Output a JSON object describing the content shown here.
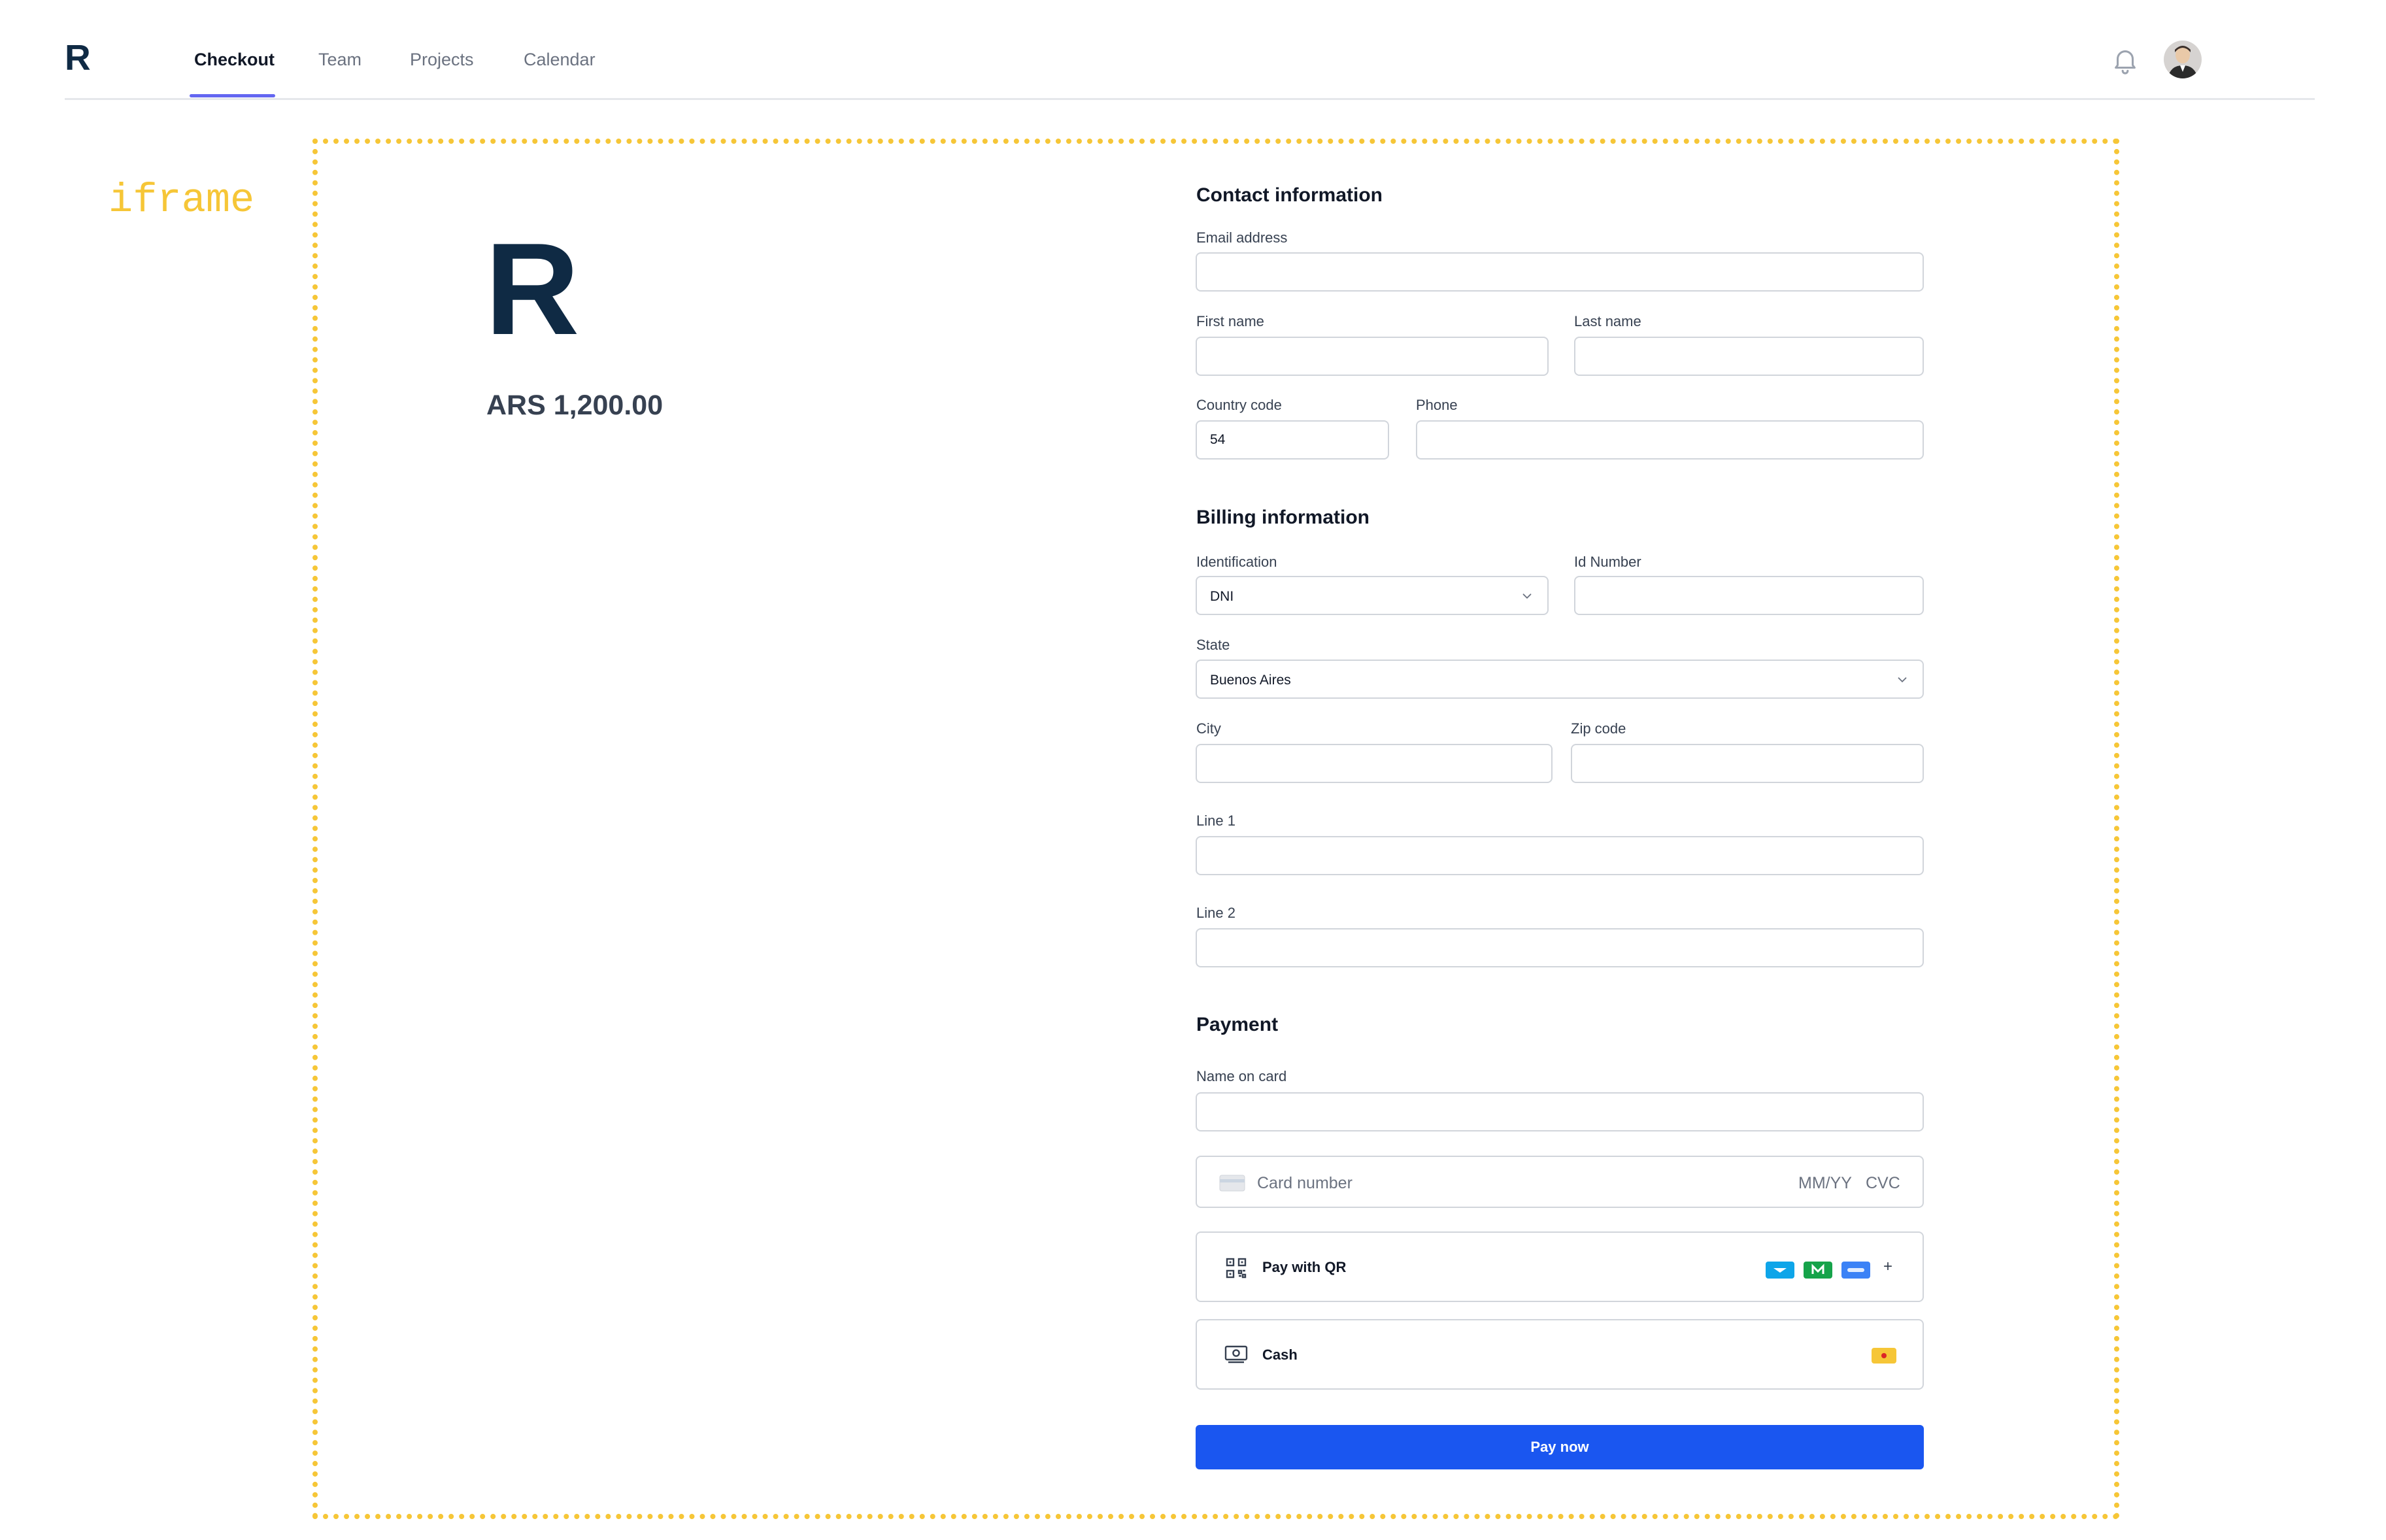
{
  "nav": {
    "brand": "R",
    "links": [
      "Checkout",
      "Team",
      "Projects",
      "Calendar"
    ]
  },
  "frame": {
    "tag": "iframe"
  },
  "summary": {
    "logo": "R",
    "amount": "ARS 1,200.00"
  },
  "contact": {
    "title": "Contact information",
    "email_label": "Email address",
    "first_name_label": "First name",
    "last_name_label": "Last name",
    "country_code_label": "Country code",
    "country_code_value": "54",
    "phone_label": "Phone"
  },
  "billing": {
    "title": "Billing information",
    "identification_label": "Identification",
    "identification_value": "DNI",
    "id_number_label": "Id Number",
    "state_label": "State",
    "state_value": "Buenos Aires",
    "city_label": "City",
    "zip_label": "Zip code",
    "line1_label": "Line 1",
    "line2_label": "Line 2"
  },
  "payment": {
    "title": "Payment",
    "name_on_card_label": "Name on card",
    "card_number_placeholder": "Card number",
    "expiry_placeholder": "MM/YY",
    "cvc_placeholder": "CVC",
    "qr_label": "Pay with QR",
    "qr_more": "+",
    "cash_label": "Cash",
    "pay_button": "Pay now"
  },
  "colors": {
    "accent": "#6366f1",
    "brand": "#0f2a44",
    "pay_button": "#1a56f0",
    "iframe_border": "#f6c637"
  },
  "icons": [
    "bell-icon",
    "avatar",
    "chevron-down-icon",
    "card-icon",
    "qr-code-icon",
    "cash-icon"
  ]
}
